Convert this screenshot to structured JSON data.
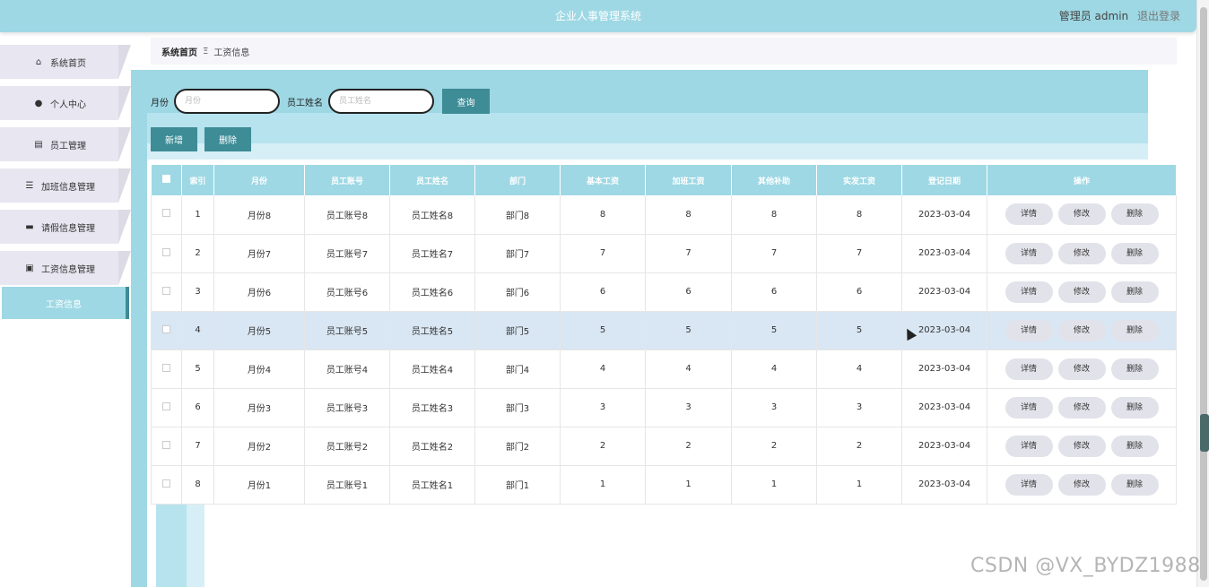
{
  "header": {
    "app_title": "企业人事管理系统",
    "user_label": "管理员 admin",
    "logout_label": "退出登录"
  },
  "sidebar": {
    "items": [
      {
        "label": "系统首页",
        "icon": "home-icon",
        "glyph": "⌂"
      },
      {
        "label": "个人中心",
        "icon": "user-icon",
        "glyph": "●"
      },
      {
        "label": "员工管理",
        "icon": "clipboard-icon",
        "glyph": "▤"
      },
      {
        "label": "加班信息管理",
        "icon": "list-icon",
        "glyph": "☰"
      },
      {
        "label": "请假信息管理",
        "icon": "monitor-icon",
        "glyph": "▬"
      },
      {
        "label": "工资信息管理",
        "icon": "briefcase-icon",
        "glyph": "▣"
      }
    ],
    "active_subitem": "工资信息"
  },
  "breadcrumb": {
    "home": "系统首页",
    "separator": "Ξ",
    "current": "工资信息"
  },
  "search": {
    "month_label": "月份",
    "month_placeholder": "月份",
    "name_label": "员工姓名",
    "name_placeholder": "员工姓名",
    "query_button": "查询"
  },
  "actions": {
    "add_button": "新增",
    "delete_button": "删除"
  },
  "table": {
    "columns": [
      "索引",
      "月份",
      "员工账号",
      "员工姓名",
      "部门",
      "基本工资",
      "加班工资",
      "其他补助",
      "实发工资",
      "登记日期",
      "操作"
    ],
    "op_labels": {
      "detail": "详情",
      "edit": "修改",
      "delete": "删除"
    },
    "rows": [
      {
        "index": "1",
        "month": "月份8",
        "account": "员工账号8",
        "name": "员工姓名8",
        "dept": "部门8",
        "base": "8",
        "overtime": "8",
        "subsidy": "8",
        "net": "8",
        "date": "2023-03-04"
      },
      {
        "index": "2",
        "month": "月份7",
        "account": "员工账号7",
        "name": "员工姓名7",
        "dept": "部门7",
        "base": "7",
        "overtime": "7",
        "subsidy": "7",
        "net": "7",
        "date": "2023-03-04"
      },
      {
        "index": "3",
        "month": "月份6",
        "account": "员工账号6",
        "name": "员工姓名6",
        "dept": "部门6",
        "base": "6",
        "overtime": "6",
        "subsidy": "6",
        "net": "6",
        "date": "2023-03-04"
      },
      {
        "index": "4",
        "month": "月份5",
        "account": "员工账号5",
        "name": "员工姓名5",
        "dept": "部门5",
        "base": "5",
        "overtime": "5",
        "subsidy": "5",
        "net": "5",
        "date": "2023-03-04"
      },
      {
        "index": "5",
        "month": "月份4",
        "account": "员工账号4",
        "name": "员工姓名4",
        "dept": "部门4",
        "base": "4",
        "overtime": "4",
        "subsidy": "4",
        "net": "4",
        "date": "2023-03-04"
      },
      {
        "index": "6",
        "month": "月份3",
        "account": "员工账号3",
        "name": "员工姓名3",
        "dept": "部门3",
        "base": "3",
        "overtime": "3",
        "subsidy": "3",
        "net": "3",
        "date": "2023-03-04"
      },
      {
        "index": "7",
        "month": "月份2",
        "account": "员工账号2",
        "name": "员工姓名2",
        "dept": "部门2",
        "base": "2",
        "overtime": "2",
        "subsidy": "2",
        "net": "2",
        "date": "2023-03-04"
      },
      {
        "index": "8",
        "month": "月份1",
        "account": "员工账号1",
        "name": "员工姓名1",
        "dept": "部门1",
        "base": "1",
        "overtime": "1",
        "subsidy": "1",
        "net": "1",
        "date": "2023-03-04"
      }
    ],
    "highlighted_row": 3
  },
  "watermark": "CSDN @VX_BYDZ1988",
  "colors": {
    "accent": "#9ed8e4",
    "button": "#3d8c96",
    "row_highlight": "#d9e6f3",
    "menu_bg": "#e8e6f0"
  }
}
